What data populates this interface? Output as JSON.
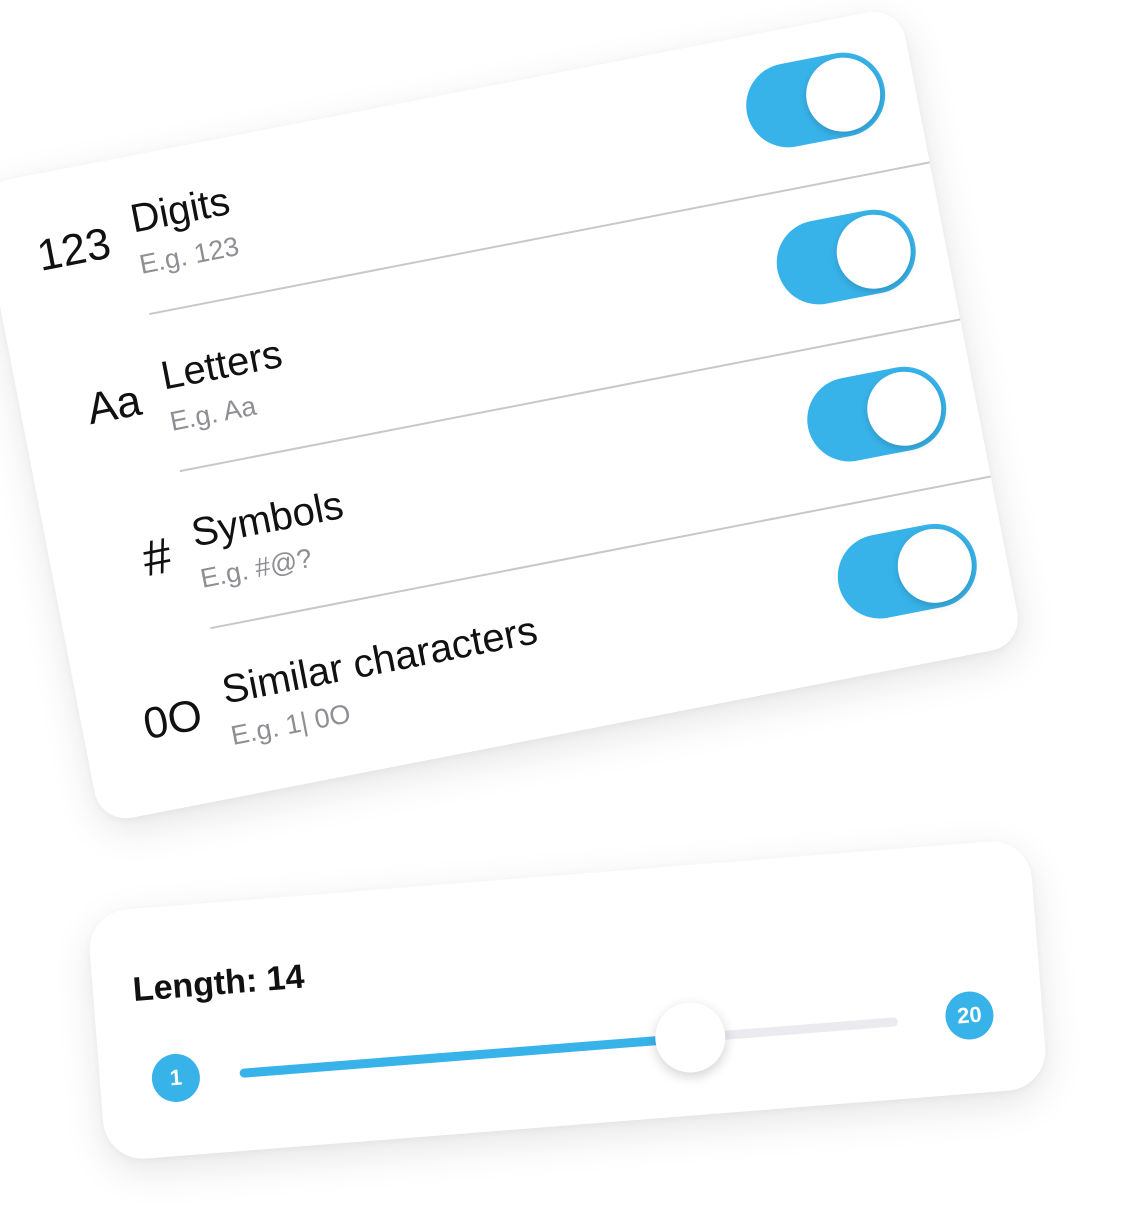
{
  "colors": {
    "accent": "#38b3ea",
    "track": "#eaeaef",
    "secondary_text": "#8e8e93"
  },
  "options": [
    {
      "icon_name": "digits-icon",
      "icon_text": "123",
      "title": "Digits",
      "example": "E.g. 123",
      "enabled": true
    },
    {
      "icon_name": "letters-icon",
      "icon_text": "Aa",
      "title": "Letters",
      "example": "E.g. Aa",
      "enabled": true
    },
    {
      "icon_name": "hash-icon",
      "icon_text": "#",
      "title": "Symbols",
      "example": "E.g. #@?",
      "enabled": true
    },
    {
      "icon_name": "similar-characters-icon",
      "icon_text": "0O",
      "title": "Similar characters",
      "example": "E.g. 1| 0O",
      "enabled": true
    }
  ],
  "length": {
    "label": "Length: 14",
    "value": 14,
    "min": 1,
    "max": 20,
    "min_label": "1",
    "max_label": "20"
  }
}
